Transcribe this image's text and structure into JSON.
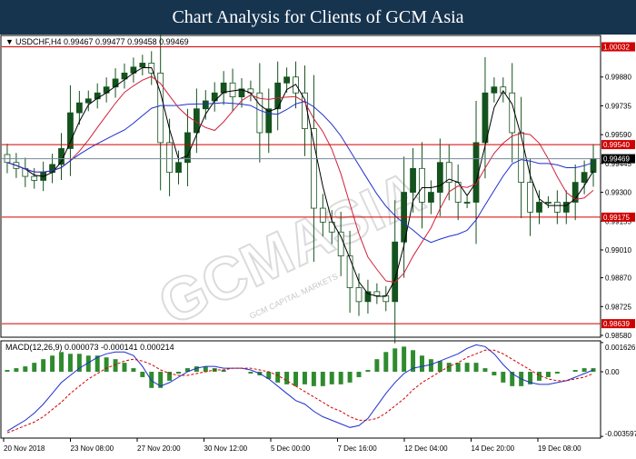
{
  "banner": {
    "title": "Chart Analysis for Clients of GCM Asia"
  },
  "watermark": {
    "text": "GCMASIA",
    "subtext": "GCM CAPITAL MARKETS"
  },
  "colors": {
    "banner_bg": "#17344f",
    "candle": "#14521e",
    "ma_fast": "#000000",
    "ma_mid": "#d0213b",
    "ma_slow": "#1f2fd0",
    "level_line": "#d00000",
    "macd_hist": "#2e8b2e",
    "macd_line": "#1f2fd0",
    "signal_line": "#d00000"
  },
  "chart_data": [
    {
      "type": "candlestick",
      "header": "USDCHF,H4  0.99467 0.99477 0.99458 0.99469",
      "ylim": [
        0.9858,
        1.0008
      ],
      "y_ticks": [
        "0.99880",
        "0.99735",
        "0.99590",
        "0.99445",
        "0.99300",
        "0.99155",
        "0.99010",
        "0.98870",
        "0.98725",
        "0.98580"
      ],
      "levels": [
        {
          "label": "1.00032",
          "value": 1.00032
        },
        {
          "label": "0.99540",
          "value": 0.9954
        },
        {
          "label": "0.99175",
          "value": 0.99175
        },
        {
          "label": "0.98639",
          "value": 0.98639
        }
      ],
      "current_price": {
        "label": "0.99469",
        "value": 0.99469
      },
      "x_ticks": [
        "20 Nov 2018",
        "23 Nov 08:00",
        "27 Nov 20:00",
        "30 Nov 12:00",
        "5 Dec 00:00",
        "7 Dec 16:00",
        "12 Dec 04:00",
        "14 Dec 20:00",
        "19 Dec 08:00"
      ],
      "close_series": [
        0.9945,
        0.9942,
        0.9938,
        0.9936,
        0.994,
        0.9944,
        0.9952,
        0.997,
        0.9975,
        0.9977,
        0.998,
        0.9983,
        0.9987,
        0.999,
        0.9993,
        0.9995,
        0.999,
        0.9955,
        0.994,
        0.9945,
        0.996,
        0.9972,
        0.9976,
        0.998,
        0.9985,
        0.9978,
        0.9982,
        0.998,
        0.996,
        0.9972,
        0.9985,
        0.9988,
        0.998,
        0.9962,
        0.9922,
        0.9915,
        0.991,
        0.9898,
        0.9882,
        0.9875,
        0.988,
        0.9878,
        0.9875,
        0.9905,
        0.993,
        0.9942,
        0.9925,
        0.993,
        0.9945,
        0.9935,
        0.9925,
        0.9925,
        0.9955,
        0.998,
        0.9983,
        0.998,
        0.996,
        0.9935,
        0.992,
        0.9925,
        0.9925,
        0.992,
        0.9925,
        0.9935,
        0.994,
        0.9947
      ]
    },
    {
      "type": "macd",
      "label": "MACD(12,26,9) 0.000073 -0.000141 0.000214",
      "ylim": [
        -0.00359,
        0.00162
      ],
      "y_ticks": [
        "0.001626",
        "0.00",
        "-0.003597"
      ],
      "macd": [
        -0.0033,
        -0.003,
        -0.0027,
        -0.0023,
        -0.0018,
        -0.0012,
        -0.0006,
        -0.0002,
        0.0002,
        0.0005,
        0.0008,
        0.001,
        0.0011,
        0.0011,
        0.0009,
        0.0003,
        -0.0005,
        -0.0008,
        -0.0006,
        -0.0003,
        0.0,
        0.0002,
        0.0003,
        0.0003,
        0.0002,
        0.0002,
        0.0002,
        0.0001,
        -0.0001,
        -0.0004,
        -0.0008,
        -0.0012,
        -0.0016,
        -0.0018,
        -0.0022,
        -0.0025,
        -0.0027,
        -0.0029,
        -0.0031,
        -0.003,
        -0.0026,
        -0.0019,
        -0.0012,
        -0.0006,
        -0.0001,
        0.0002,
        0.0003,
        0.0004,
        0.0006,
        0.0008,
        0.001,
        0.0013,
        0.0015,
        0.0014,
        0.001,
        0.0004,
        -0.0001,
        -0.0004,
        -0.0006,
        -0.0007,
        -0.0007,
        -0.0006,
        -0.0005,
        -0.0003,
        -0.0001,
        0.0001
      ],
      "signal": [
        -0.0034,
        -0.0032,
        -0.003,
        -0.0028,
        -0.0025,
        -0.0021,
        -0.0017,
        -0.0012,
        -0.0008,
        -0.0004,
        -0.0001,
        0.0002,
        0.0004,
        0.0006,
        0.0007,
        0.0006,
        0.0004,
        0.0001,
        -0.0001,
        -0.0002,
        -0.0002,
        -0.0001,
        0.0,
        0.0001,
        0.0001,
        0.0002,
        0.0002,
        0.0002,
        0.0001,
        0.0,
        -0.0002,
        -0.0005,
        -0.0008,
        -0.0011,
        -0.0014,
        -0.0017,
        -0.002,
        -0.0022,
        -0.0025,
        -0.0027,
        -0.0027,
        -0.0026,
        -0.0023,
        -0.0019,
        -0.0015,
        -0.001,
        -0.0006,
        -0.0003,
        0.0,
        0.0003,
        0.0005,
        0.0008,
        0.001,
        0.0012,
        0.0012,
        0.001,
        0.0007,
        0.0004,
        0.0001,
        -0.0002,
        -0.0004,
        -0.0005,
        -0.0005,
        -0.0004,
        -0.0003,
        -0.0001
      ]
    }
  ]
}
